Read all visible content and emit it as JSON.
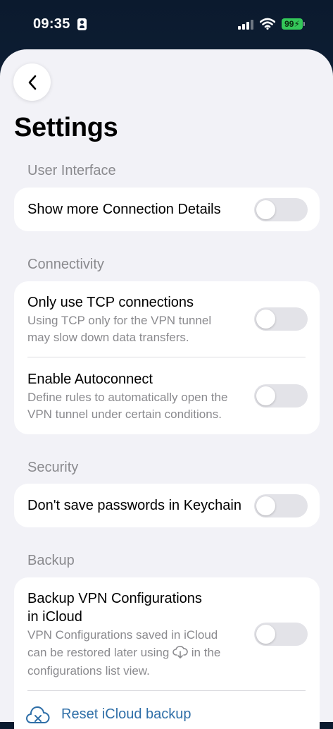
{
  "status_bar": {
    "time": "09:35",
    "battery": "99"
  },
  "header": {
    "title": "Settings"
  },
  "sections": {
    "user_interface": {
      "header": "User Interface",
      "show_details": {
        "title": "Show more Connection Details",
        "enabled": false
      }
    },
    "connectivity": {
      "header": "Connectivity",
      "tcp": {
        "title": "Only use TCP connections",
        "subtitle_1": "Using TCP only for the VPN tunnel",
        "subtitle_2": "may slow down data transfers.",
        "enabled": false
      },
      "autoconnect": {
        "title": "Enable Autoconnect",
        "subtitle_1": "Define rules to automatically open the",
        "subtitle_2": "VPN tunnel under certain conditions.",
        "enabled": false
      }
    },
    "security": {
      "header": "Security",
      "keychain": {
        "title": "Don't save passwords in Keychain",
        "enabled": false
      }
    },
    "backup": {
      "header": "Backup",
      "icloud": {
        "title_1": "Backup VPN Configurations",
        "title_2": "in iCloud",
        "subtitle_1": "VPN Configurations saved in iCloud",
        "subtitle_2a": "can be restored later using",
        "subtitle_2b": "in the",
        "subtitle_3": "configurations list view.",
        "enabled": false
      },
      "reset_label": "Reset iCloud backup"
    }
  },
  "colors": {
    "accent": "#2f6fa8",
    "toggle_off": "#e3e3e8",
    "battery": "#34c759"
  },
  "icons": {
    "back": "chevron-left-icon",
    "reset": "cloud-x-icon",
    "inline": "cloud-download-icon"
  }
}
